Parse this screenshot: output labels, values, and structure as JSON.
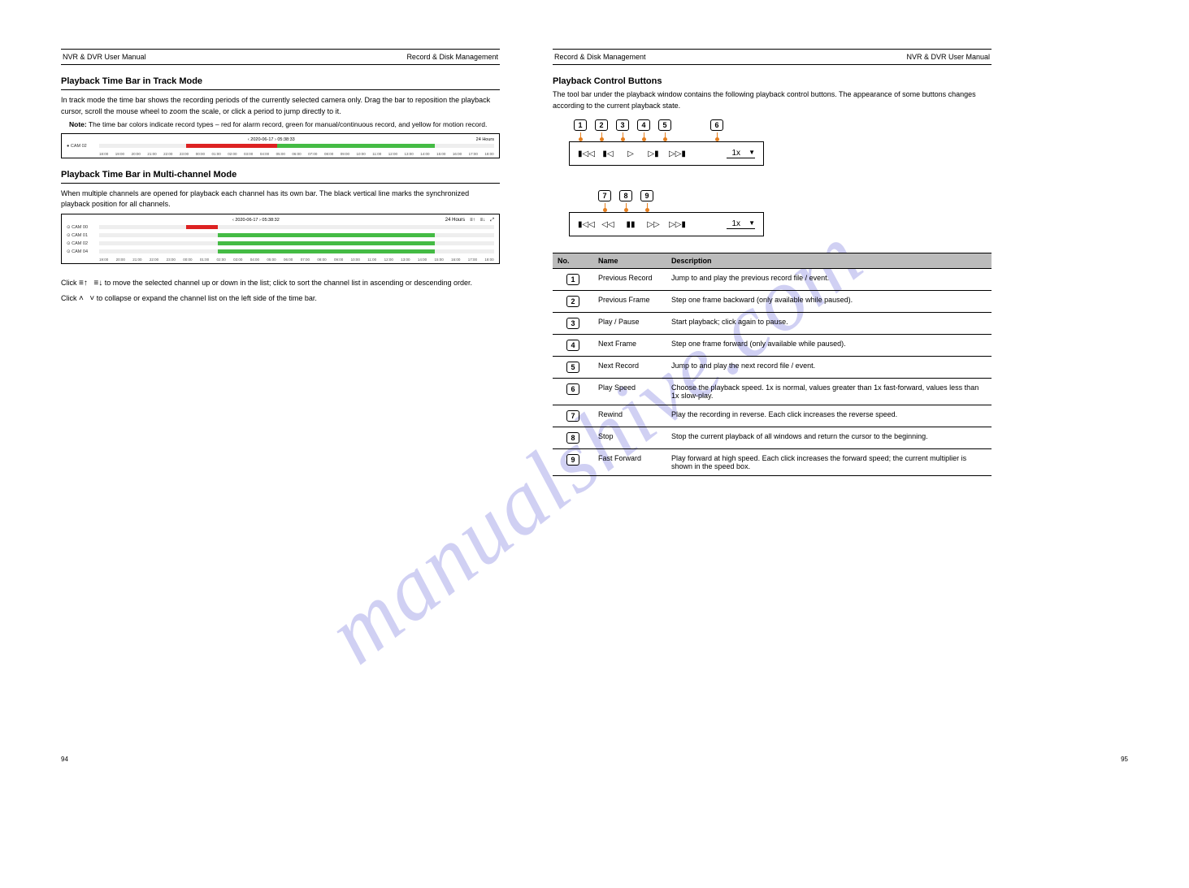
{
  "header": {
    "title_left": "NVR & DVR User Manual",
    "page_left": "94",
    "section_left": "Record & Disk Management",
    "title_right": "NVR & DVR User Manual",
    "page_right": "95",
    "section_right": "Record & Disk Management"
  },
  "left": {
    "h_track": "Playback Time Bar in Track Mode",
    "track_text": "In track mode the time bar shows the recording periods of the currently selected camera only. Drag the bar to reposition the playback cursor, scroll the mouse wheel to zoom the scale, or click a period to jump directly to it.",
    "note_lbl": "Note:",
    "note_text": "The time bar colors indicate record types – red for alarm record, green for manual/continuous record, and yellow for motion record.",
    "timeline1": {
      "cam": "CAM 02",
      "date": "2020-06-17",
      "cursor": "05:38:33",
      "scale": "24 Hours",
      "ticks": [
        "18:00",
        "19:00",
        "20:00",
        "21:00",
        "22:00",
        "23:00",
        "00:00",
        "01:00",
        "02:00",
        "03:00",
        "04:00",
        "05:00",
        "06:00",
        "07:00",
        "08:00",
        "09:00",
        "10:00",
        "11:00",
        "12:00",
        "13:00",
        "14:00",
        "15:00",
        "16:00",
        "17:00",
        "18:00"
      ]
    },
    "h_multi": "Playback Time Bar in Multi-channel Mode",
    "multi_text": "When multiple channels are opened for playback each channel has its own bar. The black vertical line marks the synchronized playback position for all channels.",
    "timeline2": {
      "cams": [
        "CAM 00",
        "CAM 01",
        "CAM 02",
        "CAM 04"
      ],
      "date": "2020-06-17",
      "cursor": "05:38:32",
      "scale": "24 Hours",
      "ticks": [
        "19:00",
        "20:00",
        "21:00",
        "22:00",
        "23:00",
        "00:00",
        "01:00",
        "02:00",
        "03:00",
        "04:00",
        "05:00",
        "06:00",
        "07:00",
        "08:00",
        "09:00",
        "10:00",
        "11:00",
        "12:00",
        "13:00",
        "14:00",
        "15:00",
        "16:00",
        "17:00",
        "18:00"
      ]
    },
    "sort_text_a": "Click ",
    "sort_text_b": " to move the selected channel up or down in the list; click ",
    "sort_text_c": " to sort the channel list in ascending or descending order.",
    "chev_text_a": "Click ",
    "chev_text_b": " to collapse or expand the channel list on the left side of the time bar."
  },
  "right": {
    "h_buttons": "Playback Control Buttons",
    "intro": "The tool bar under the playback window contains the following playback control buttons. The appearance of some buttons changes according to the current playback state.",
    "bar1": {
      "nums": [
        "1",
        "2",
        "3",
        "4",
        "5",
        "6"
      ],
      "speed": "1x"
    },
    "bar2": {
      "nums": [
        "7",
        "8",
        "9"
      ],
      "speed": "1x"
    },
    "table": {
      "head_no": "No.",
      "head_name": "Name",
      "head_desc": "Description",
      "rows": [
        {
          "n": "1",
          "name": "Previous Record",
          "desc": "Jump to and play the previous record file / event."
        },
        {
          "n": "2",
          "name": "Previous Frame",
          "desc": "Step one frame backward (only available while paused)."
        },
        {
          "n": "3",
          "name": "Play / Pause",
          "desc": "Start playback; click again to pause."
        },
        {
          "n": "4",
          "name": "Next Frame",
          "desc": "Step one frame forward (only available while paused)."
        },
        {
          "n": "5",
          "name": "Next Record",
          "desc": "Jump to and play the next record file / event."
        },
        {
          "n": "6",
          "name": "Play Speed",
          "desc": "Choose the playback speed. 1x is normal, values greater than 1x fast-forward, values less than 1x slow-play."
        },
        {
          "n": "7",
          "name": "Rewind",
          "desc": "Play the recording in reverse. Each click increases the reverse speed."
        },
        {
          "n": "8",
          "name": "Stop",
          "desc": "Stop the current playback of all windows and return the cursor to the beginning."
        },
        {
          "n": "9",
          "name": "Fast Forward",
          "desc": "Play forward at high speed. Each click increases the forward speed; the current multiplier is shown in the speed box."
        }
      ]
    }
  },
  "footer": {
    "left": "94",
    "right": "95"
  },
  "icons": {
    "sortUp": "≡↑",
    "sortDown": "≡↓",
    "chevUp": "˄",
    "chevDown": "˅",
    "skipBack": "▮◁◁",
    "prevFrame": "▮◁",
    "play": "▷",
    "nextFrame": "▷▮",
    "skipFwd": "▷▷▮",
    "rewind": "◁◁",
    "stop": "▮▮",
    "ffwd": "▷▷"
  }
}
